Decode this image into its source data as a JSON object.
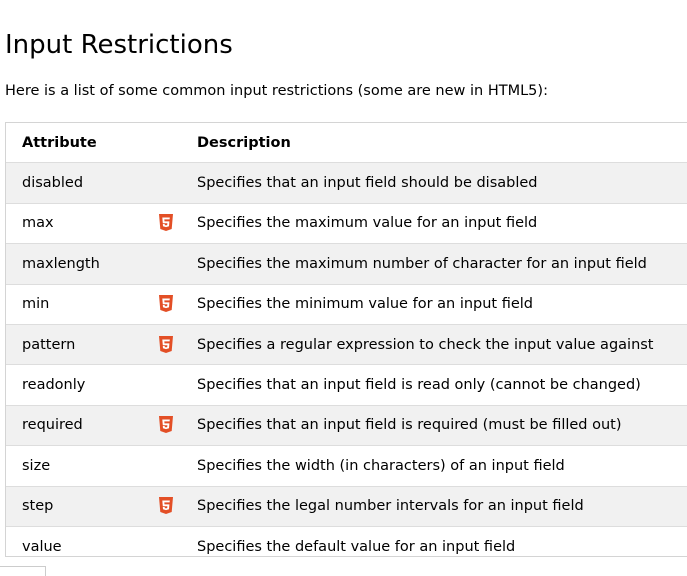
{
  "page": {
    "title": "Input Restrictions",
    "intro": "Here is a list of some common input restrictions (some are new in HTML5):"
  },
  "table": {
    "headers": {
      "attribute": "Attribute",
      "description": "Description"
    },
    "rows": [
      {
        "attribute": "disabled",
        "html5": false,
        "description": "Specifies that an input field should be disabled"
      },
      {
        "attribute": "max",
        "html5": true,
        "description": "Specifies the maximum value for an input field"
      },
      {
        "attribute": "maxlength",
        "html5": false,
        "description": "Specifies the maximum number of character for an input field"
      },
      {
        "attribute": "min",
        "html5": true,
        "description": "Specifies the minimum value for an input field"
      },
      {
        "attribute": "pattern",
        "html5": true,
        "description": "Specifies a regular expression to check the input value against"
      },
      {
        "attribute": "readonly",
        "html5": false,
        "description": "Specifies that an input field is read only (cannot be changed)"
      },
      {
        "attribute": "required",
        "html5": true,
        "description": "Specifies that an input field is required (must be filled out)"
      },
      {
        "attribute": "size",
        "html5": false,
        "description": "Specifies the width (in characters) of an input field"
      },
      {
        "attribute": "step",
        "html5": true,
        "description": "Specifies the legal number intervals for an input field"
      },
      {
        "attribute": "value",
        "html5": false,
        "description": "Specifies the default value for an input field"
      }
    ]
  },
  "icons": {
    "html5_badge": "html5-icon"
  },
  "colors": {
    "html5_badge": "#e34f26",
    "row_stripe": "#f1f1f1",
    "border": "#d4d4d4"
  }
}
